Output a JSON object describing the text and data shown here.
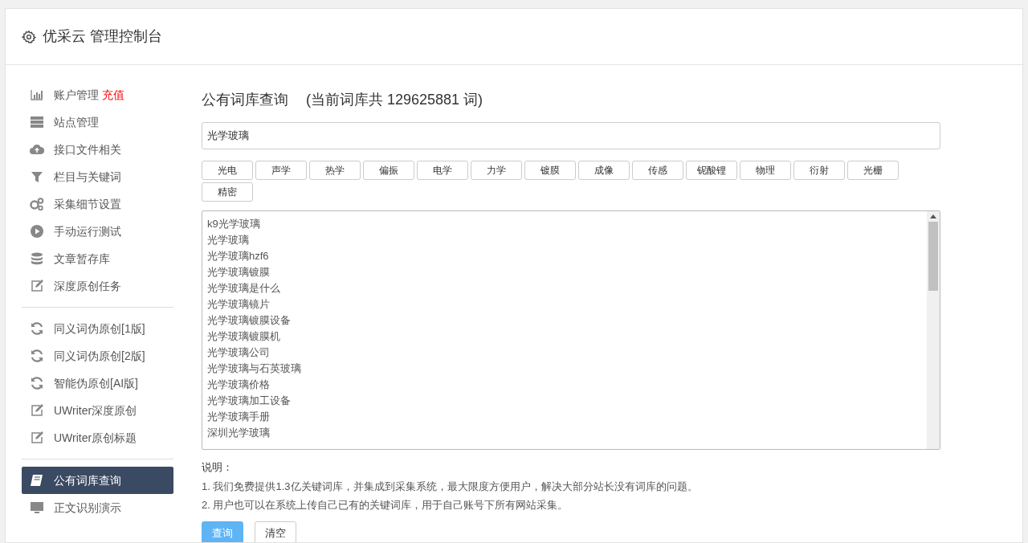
{
  "header": {
    "title": "优采云 管理控制台"
  },
  "sidebar": {
    "groups": [
      [
        {
          "kind": "chart",
          "label": "账户管理",
          "badge": "充值",
          "selected": false
        },
        {
          "kind": "server",
          "label": "站点管理",
          "selected": false
        },
        {
          "kind": "cloud",
          "label": "接口文件相关",
          "selected": false
        },
        {
          "kind": "filter",
          "label": "栏目与关键词",
          "selected": false
        },
        {
          "kind": "gears",
          "label": "采集细节设置",
          "selected": false
        },
        {
          "kind": "play",
          "label": "手动运行测试",
          "selected": false
        },
        {
          "kind": "database",
          "label": "文章暂存库",
          "selected": false
        },
        {
          "kind": "edit",
          "label": "深度原创任务",
          "selected": false
        }
      ],
      [
        {
          "kind": "refresh",
          "label": "同义词伪原创[1版]",
          "selected": false
        },
        {
          "kind": "refresh",
          "label": "同义词伪原创[2版]",
          "selected": false
        },
        {
          "kind": "refresh",
          "label": "智能伪原创[AI版]",
          "selected": false
        },
        {
          "kind": "edit",
          "label": "UWriter深度原创",
          "selected": false
        },
        {
          "kind": "edit",
          "label": "UWriter原创标题",
          "selected": false
        }
      ],
      [
        {
          "kind": "book",
          "label": "公有词库查询",
          "selected": true
        },
        {
          "kind": "monitor",
          "label": "正文识别演示",
          "selected": false
        }
      ]
    ]
  },
  "main": {
    "title": "公有词库查询",
    "count": "(当前词库共 129625881 词)",
    "search": {
      "value": "光学玻璃"
    },
    "tags": [
      "光电",
      "声学",
      "热学",
      "偏振",
      "电学",
      "力学",
      "镀膜",
      "成像",
      "传感",
      "铌酸锂",
      "物理",
      "衍射",
      "光栅",
      "精密"
    ],
    "results": [
      "k9光学玻璃",
      "光学玻璃",
      "光学玻璃hzf6",
      "光学玻璃镀膜",
      "光学玻璃是什么",
      "光学玻璃镜片",
      "光学玻璃镀膜设备",
      "光学玻璃镀膜机",
      "光学玻璃公司",
      "光学玻璃与石英玻璃",
      "光学玻璃价格",
      "光学玻璃加工设备",
      "光学玻璃手册",
      "深圳光学玻璃"
    ],
    "notes": {
      "label": "说明：",
      "lines": [
        "1. 我们免费提供1.3亿关键词库，并集成到采集系统，最大限度方便用户，解决大部分站长没有词库的问题。",
        "2. 用户也可以在系统上传自己已有的关键词库，用于自己账号下所有网站采集。"
      ]
    },
    "buttons": [
      {
        "kind": "primary",
        "label": "查询"
      },
      {
        "kind": "default",
        "label": "清空"
      }
    ]
  }
}
